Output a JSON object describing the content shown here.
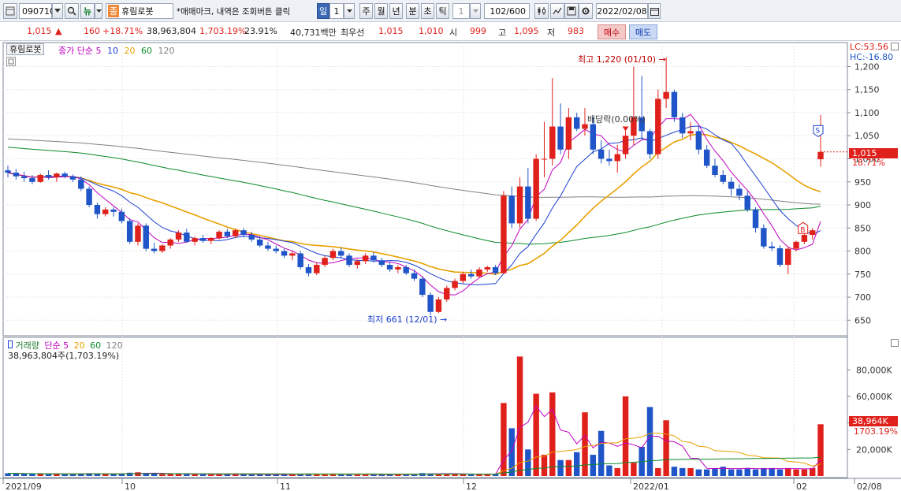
{
  "toolbar": {
    "code": "090710",
    "name_tag": "종",
    "name": "휴림로봇",
    "notice": "*매매마크, 내역은 조회버튼 클릭",
    "period_tabs": [
      "일",
      "주",
      "월",
      "년",
      "분",
      "초",
      "틱"
    ],
    "active_period_value": "1",
    "tick_value": "1",
    "count": "102",
    "count_total": "/600",
    "date": "2022/02/08"
  },
  "quote": {
    "price": "1,015",
    "change": "160",
    "change_pct": "+18.71%",
    "volume": "38,963,804",
    "volume_pct": "1,703.19%",
    "turnover": "23.91%",
    "amount": "40,731백만",
    "best_label": "최우선",
    "best_ask": "1,015",
    "best_bid": "1,010",
    "open_label": "시",
    "open": "999",
    "high_label": "고",
    "high": "1,095",
    "low_label": "저",
    "low": "983",
    "buy_label": "매수",
    "sell_label": "매도"
  },
  "colors": {
    "up": "#e0201a",
    "down": "#1f55c8",
    "ma5": "#c000c0",
    "ma10": "#1a3fd0",
    "ma20": "#e8a000",
    "ma60": "#0a8a2a",
    "ma120": "#808080"
  },
  "chart_data": {
    "type": "candlestick",
    "title": "휴림로봇",
    "legend": [
      "종가 단순",
      "5",
      "10",
      "20",
      "60",
      "120"
    ],
    "price_axis": {
      "ticks": [
        "1,200",
        "1,150",
        "1,100",
        "1,050",
        "1,000",
        "950",
        "900",
        "850",
        "800",
        "750",
        "700",
        "650"
      ],
      "range": [
        630,
        1235
      ]
    },
    "price_labels": {
      "lc": "LC:53.56",
      "hc": "HC:-16.80",
      "last": "1,015",
      "last_pct": "18.71%"
    },
    "annotations": {
      "high": "최고 1,220 (01/10)",
      "low": "최저 661 (12/01)",
      "dividend": "배당락(0.00%)",
      "sell_marker": "S",
      "buy_marker": "B"
    },
    "x_labels": [
      "2021/09",
      "10",
      "11",
      "12",
      "2022/01",
      "02",
      "02/08"
    ],
    "candles": [
      [
        975,
        985,
        960,
        970
      ],
      [
        970,
        978,
        955,
        962
      ],
      [
        962,
        972,
        950,
        958
      ],
      [
        958,
        965,
        945,
        950
      ],
      [
        950,
        968,
        948,
        965
      ],
      [
        965,
        975,
        955,
        960
      ],
      [
        960,
        970,
        950,
        968
      ],
      [
        968,
        972,
        958,
        962
      ],
      [
        962,
        966,
        950,
        955
      ],
      [
        955,
        962,
        930,
        935
      ],
      [
        935,
        940,
        895,
        900
      ],
      [
        900,
        905,
        870,
        880
      ],
      [
        880,
        895,
        875,
        890
      ],
      [
        890,
        895,
        875,
        885
      ],
      [
        885,
        892,
        860,
        865
      ],
      [
        865,
        872,
        815,
        820
      ],
      [
        820,
        860,
        812,
        855
      ],
      [
        855,
        860,
        800,
        805
      ],
      [
        805,
        818,
        795,
        800
      ],
      [
        800,
        815,
        796,
        812
      ],
      [
        812,
        828,
        805,
        825
      ],
      [
        825,
        845,
        820,
        840
      ],
      [
        840,
        848,
        818,
        820
      ],
      [
        820,
        832,
        812,
        828
      ],
      [
        828,
        835,
        818,
        822
      ],
      [
        822,
        830,
        815,
        828
      ],
      [
        828,
        845,
        825,
        842
      ],
      [
        842,
        848,
        828,
        832
      ],
      [
        832,
        848,
        828,
        845
      ],
      [
        845,
        850,
        830,
        835
      ],
      [
        835,
        842,
        820,
        825
      ],
      [
        825,
        832,
        808,
        812
      ],
      [
        812,
        820,
        800,
        805
      ],
      [
        805,
        812,
        795,
        800
      ],
      [
        800,
        805,
        785,
        790
      ],
      [
        790,
        800,
        780,
        795
      ],
      [
        795,
        800,
        760,
        765
      ],
      [
        765,
        772,
        745,
        752
      ],
      [
        752,
        775,
        748,
        770
      ],
      [
        770,
        790,
        765,
        785
      ],
      [
        785,
        805,
        780,
        800
      ],
      [
        800,
        808,
        785,
        790
      ],
      [
        790,
        795,
        765,
        770
      ],
      [
        770,
        782,
        762,
        778
      ],
      [
        778,
        795,
        772,
        790
      ],
      [
        790,
        798,
        775,
        780
      ],
      [
        780,
        785,
        765,
        770
      ],
      [
        770,
        775,
        755,
        760
      ],
      [
        760,
        770,
        752,
        765
      ],
      [
        765,
        770,
        748,
        752
      ],
      [
        752,
        760,
        735,
        740
      ],
      [
        740,
        745,
        700,
        705
      ],
      [
        705,
        710,
        661,
        668
      ],
      [
        668,
        700,
        665,
        695
      ],
      [
        695,
        725,
        690,
        720
      ],
      [
        720,
        740,
        715,
        735
      ],
      [
        735,
        755,
        730,
        750
      ],
      [
        750,
        760,
        740,
        745
      ],
      [
        745,
        765,
        742,
        760
      ],
      [
        760,
        768,
        755,
        765
      ],
      [
        765,
        770,
        748,
        752
      ],
      [
        752,
        930,
        750,
        920
      ],
      [
        920,
        940,
        850,
        860
      ],
      [
        860,
        960,
        850,
        940
      ],
      [
        940,
        980,
        860,
        870
      ],
      [
        870,
        1010,
        865,
        1000
      ],
      [
        1000,
        1080,
        960,
        1000
      ],
      [
        1000,
        1175,
        985,
        1070
      ],
      [
        1070,
        1120,
        1010,
        1020
      ],
      [
        1020,
        1110,
        1000,
        1090
      ],
      [
        1090,
        1100,
        1060,
        1065
      ],
      [
        1065,
        1110,
        1050,
        1075
      ],
      [
        1075,
        1090,
        1010,
        1020
      ],
      [
        1020,
        1040,
        990,
        1000
      ],
      [
        1000,
        1020,
        985,
        995
      ],
      [
        995,
        1030,
        970,
        1010
      ],
      [
        1010,
        1060,
        1000,
        1050
      ],
      [
        1050,
        1200,
        1030,
        1090
      ],
      [
        1090,
        1180,
        1040,
        1060
      ],
      [
        1060,
        1065,
        1000,
        1010
      ],
      [
        1010,
        1150,
        1000,
        1130
      ],
      [
        1130,
        1220,
        1110,
        1145
      ],
      [
        1145,
        1150,
        1080,
        1090
      ],
      [
        1090,
        1100,
        1045,
        1055
      ],
      [
        1055,
        1080,
        1040,
        1060
      ],
      [
        1060,
        1070,
        1010,
        1020
      ],
      [
        1020,
        1030,
        980,
        985
      ],
      [
        985,
        1000,
        960,
        965
      ],
      [
        965,
        975,
        945,
        950
      ],
      [
        950,
        960,
        920,
        935
      ],
      [
        935,
        945,
        910,
        920
      ],
      [
        920,
        930,
        885,
        890
      ],
      [
        890,
        895,
        840,
        850
      ],
      [
        850,
        858,
        805,
        810
      ],
      [
        810,
        820,
        800,
        806
      ],
      [
        806,
        812,
        765,
        770
      ],
      [
        770,
        810,
        750,
        805
      ],
      [
        805,
        822,
        800,
        820
      ],
      [
        820,
        840,
        815,
        835
      ],
      [
        835,
        850,
        825,
        845
      ],
      [
        999,
        1095,
        983,
        1015
      ]
    ],
    "volumes": [
      2.1,
      1.9,
      1.6,
      1.5,
      1.8,
      1.4,
      1.6,
      1.3,
      1.2,
      2.0,
      2.2,
      1.8,
      1.5,
      1.4,
      1.7,
      2.5,
      2.8,
      2.0,
      1.6,
      1.4,
      1.5,
      1.9,
      1.7,
      1.3,
      1.2,
      1.1,
      1.6,
      1.3,
      1.4,
      1.2,
      1.1,
      1.3,
      1.2,
      1.0,
      1.2,
      1.1,
      1.6,
      1.8,
      1.4,
      1.3,
      1.5,
      1.2,
      1.3,
      1.1,
      1.2,
      1.0,
      1.1,
      1.2,
      1.0,
      1.3,
      1.5,
      2.2,
      1.9,
      1.6,
      1.8,
      1.4,
      1.5,
      1.2,
      1.3,
      1.2,
      1.4,
      55,
      36,
      90,
      20,
      62,
      16,
      63,
      12,
      12,
      18,
      48,
      16,
      34,
      8,
      6,
      60,
      10,
      22,
      52,
      6,
      42,
      7,
      6,
      6,
      5,
      5,
      6,
      7,
      5,
      5,
      6,
      5,
      6,
      6,
      5,
      6,
      5,
      5,
      6,
      39
    ]
  },
  "volume_panel": {
    "legend_label": "거래량",
    "legend_items": [
      "단순",
      "5",
      "20",
      "60",
      "120"
    ],
    "current": "38,963,804주(1,703.19%)",
    "axis_ticks": [
      "80,000K",
      "60,000K",
      "40,000K",
      "20,000K"
    ],
    "last": "38,964K",
    "last_pct": "1703.19%"
  }
}
